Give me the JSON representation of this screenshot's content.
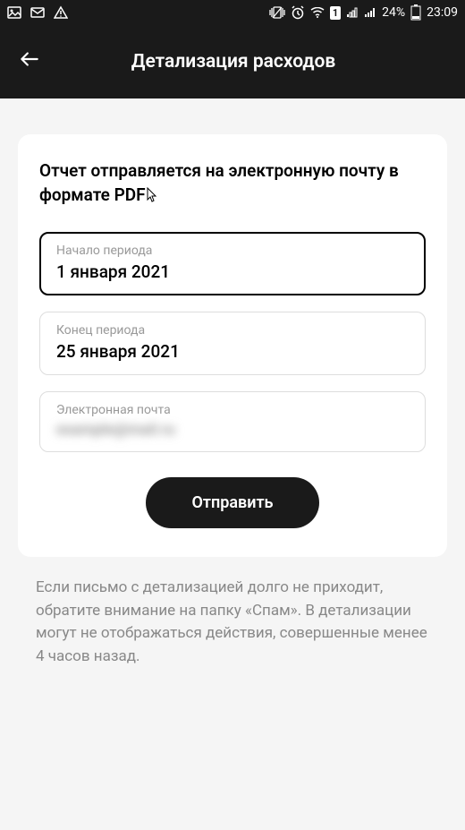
{
  "status_bar": {
    "battery_percent": "24%",
    "time": "23:09",
    "sim_number": "1"
  },
  "header": {
    "title": "Детализация расходов"
  },
  "card": {
    "heading": "Отчет отправляется на электронную почту в формате PDF",
    "start_date": {
      "label": "Начало периода",
      "value": "1 января 2021"
    },
    "end_date": {
      "label": "Конец периода",
      "value": "25 января 2021"
    },
    "email": {
      "label": "Электронная почта",
      "value": "example@mail.ru"
    },
    "submit_label": "Отправить"
  },
  "help_text": "Если письмо с детализацией долго не приходит, обратите внимание на папку «Спам». В детализации могут не отображаться действия, совершенные менее 4 часов назад."
}
